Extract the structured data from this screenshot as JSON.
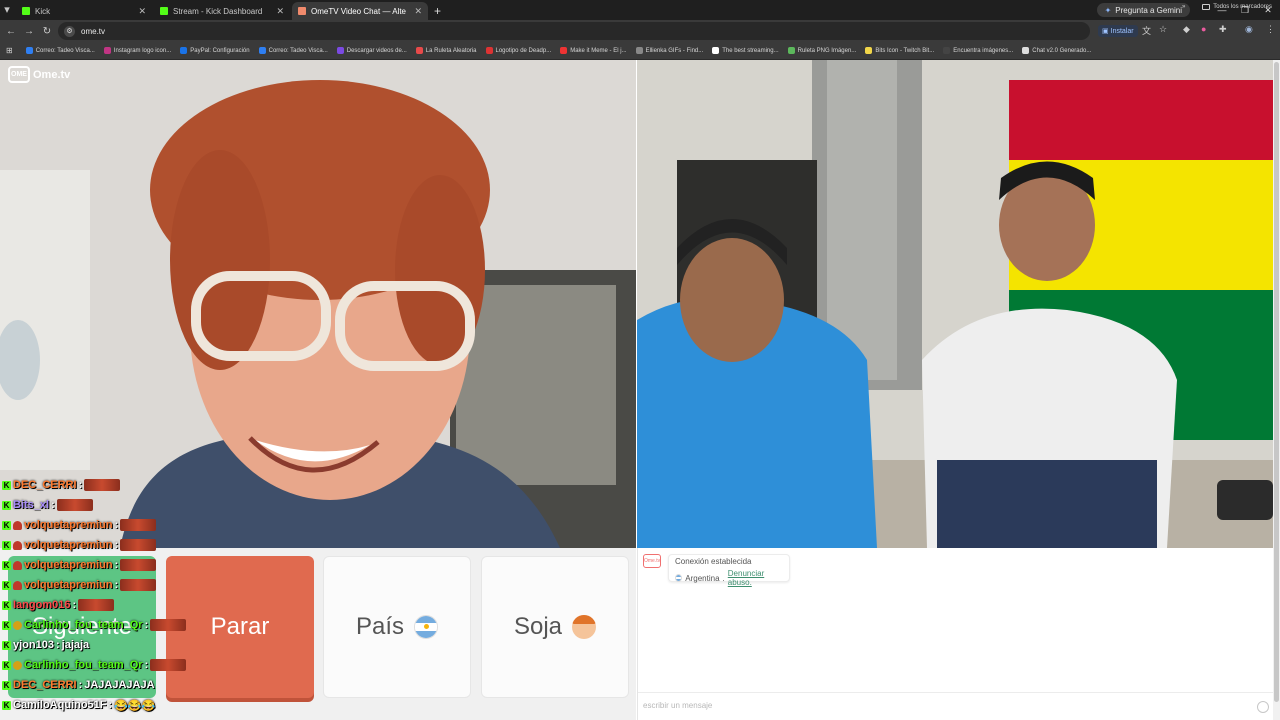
{
  "browser": {
    "tabs": [
      {
        "label": "Kick",
        "fav": "#53fc18",
        "active": false
      },
      {
        "label": "Stream - Kick Dashboard",
        "fav": "#53fc18",
        "active": false
      },
      {
        "label": "OmeTV Video Chat — Alte",
        "fav": "#f08a6c",
        "active": true
      }
    ],
    "new_tab": "+",
    "gemini": "Pregunta a Gemini",
    "url": "ome.tv",
    "install": "Instalar",
    "bookmarks": [
      {
        "label": "Correo: Tadeo Visca...",
        "color": "#2f7ff2"
      },
      {
        "label": "Instagram logo icon...",
        "color": "#c13584"
      },
      {
        "label": "PayPal: Configuración",
        "color": "#1a73e8"
      },
      {
        "label": "Correo: Tadeo Visca...",
        "color": "#2f7ff2"
      },
      {
        "label": "Descargar videos de...",
        "color": "#7b4ae2"
      },
      {
        "label": "La Ruleta Aleatoria",
        "color": "#e84a4a"
      },
      {
        "label": "Logotipo de Deadp...",
        "color": "#d33"
      },
      {
        "label": "Make it Meme - El j...",
        "color": "#e33"
      },
      {
        "label": "Ellienka GIFs - Find...",
        "color": "#888"
      },
      {
        "label": "The best streaming...",
        "color": "#ffffff"
      },
      {
        "label": "Ruleta PNG Imágen...",
        "color": "#5cb85c"
      },
      {
        "label": "Bits Icon - Twitch Bit...",
        "color": "#f2d649"
      },
      {
        "label": "Encuentra imágenes...",
        "color": "#444"
      },
      {
        "label": "Chat v2.0 Generado...",
        "color": "#ddd"
      }
    ],
    "all_bookmarks": "Todos los marcadores"
  },
  "site": {
    "logo_mark": "OME",
    "logo_text": "Ome.tv"
  },
  "controls": {
    "start": "Siguiente",
    "stop": "Parar",
    "country": "País",
    "gender": "Soja"
  },
  "chat_overlay": [
    {
      "user": "DEC_CERRI",
      "color": "orange",
      "badges": [
        "kick"
      ],
      "msg": "",
      "emotes": 1
    },
    {
      "user": "Bits_xl",
      "color": "purple",
      "badges": [
        "kick"
      ],
      "msg": "",
      "emotes": 1
    },
    {
      "user": "volquetapremiun",
      "color": "orange",
      "badges": [
        "kick",
        "sub"
      ],
      "msg": "",
      "emotes": 1
    },
    {
      "user": "volquetapremiun",
      "color": "orange",
      "badges": [
        "kick",
        "sub"
      ],
      "msg": "",
      "emotes": 1
    },
    {
      "user": "volquetapremiun",
      "color": "orange",
      "badges": [
        "kick",
        "sub"
      ],
      "msg": "",
      "emotes": 1
    },
    {
      "user": "volquetapremiun",
      "color": "orange",
      "badges": [
        "kick",
        "sub"
      ],
      "msg": "",
      "emotes": 1
    },
    {
      "user": "Iangom016",
      "color": "red",
      "badges": [
        "kick"
      ],
      "msg": "",
      "emotes": 1
    },
    {
      "user": "Carlinho_fou_team_Qr",
      "color": "green",
      "badges": [
        "kick",
        "gold"
      ],
      "msg": "",
      "emotes": 1
    },
    {
      "user": "yjon103",
      "color": "white",
      "badges": [
        "kick"
      ],
      "msg": "jajaja",
      "emotes": 0
    },
    {
      "user": "Carlinho_fou_team_Qr",
      "color": "green",
      "badges": [
        "kick",
        "gold"
      ],
      "msg": "",
      "emotes": 1
    },
    {
      "user": "DEC_CERRI",
      "color": "orange",
      "badges": [
        "kick"
      ],
      "msg": "JAJAJAJAJA",
      "emotes": 0
    },
    {
      "user": "CamiloAquino51F",
      "color": "white",
      "badges": [
        "kick"
      ],
      "msg": "😂😂😂",
      "emotes": 0
    }
  ],
  "chat_panel": {
    "system_logo": "Ome.tv",
    "status": "Conexión establecida",
    "country": "Argentina",
    "separator": ".",
    "report": "Denunciar abuso.",
    "input_placeholder": "escribir un mensaje"
  },
  "colors": {
    "accent_orange": "#e06a4f",
    "accent_green": "#5dc584",
    "kick_green": "#53fc18"
  }
}
